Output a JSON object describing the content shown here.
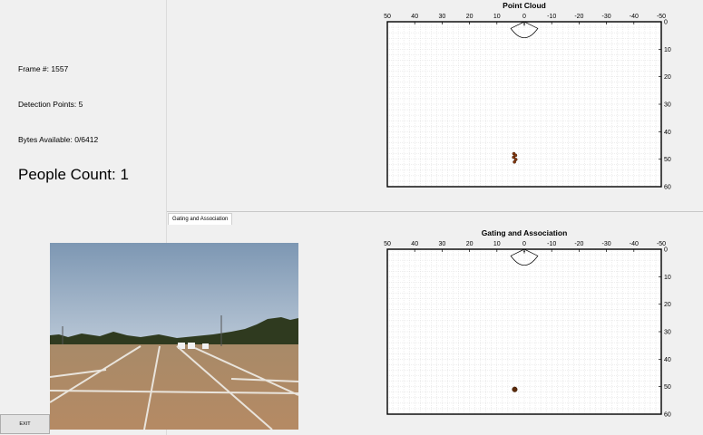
{
  "left": {
    "frame": "Frame #: 1557",
    "points": "Detection Points: 5",
    "bytes": "Bytes Available: 0/6412",
    "people": "People Count: 1"
  },
  "tab_label": "Gating and Association",
  "exit_label": "EXIT",
  "chart_data": [
    {
      "type": "scatter",
      "title": "Point Cloud",
      "x_ticks": [
        50,
        40,
        30,
        20,
        10,
        0,
        -10,
        -20,
        -30,
        -40,
        -50
      ],
      "y_ticks": [
        0,
        10,
        20,
        30,
        40,
        50,
        60
      ],
      "xlim": [
        50,
        -50
      ],
      "ylim": [
        0,
        60
      ],
      "grid": true,
      "sensor_fov_label": "0",
      "points": [
        {
          "x": 3.8,
          "y": 48.0
        },
        {
          "x": 3.2,
          "y": 48.6
        },
        {
          "x": 3.9,
          "y": 49.3
        },
        {
          "x": 3.1,
          "y": 50.1
        },
        {
          "x": 3.6,
          "y": 51.0
        }
      ],
      "point_color": "#8b3a10"
    },
    {
      "type": "scatter",
      "title": "Gating and Association",
      "x_ticks": [
        50,
        40,
        30,
        20,
        10,
        0,
        -10,
        -20,
        -30,
        -40,
        -50
      ],
      "y_ticks": [
        0,
        10,
        20,
        30,
        40,
        50,
        60
      ],
      "xlim": [
        50,
        -50
      ],
      "ylim": [
        0,
        60
      ],
      "grid": true,
      "sensor_fov_label": "0",
      "points": [
        {
          "x": 3.5,
          "y": 51.0
        }
      ],
      "point_color": "#5a2a0a"
    }
  ]
}
